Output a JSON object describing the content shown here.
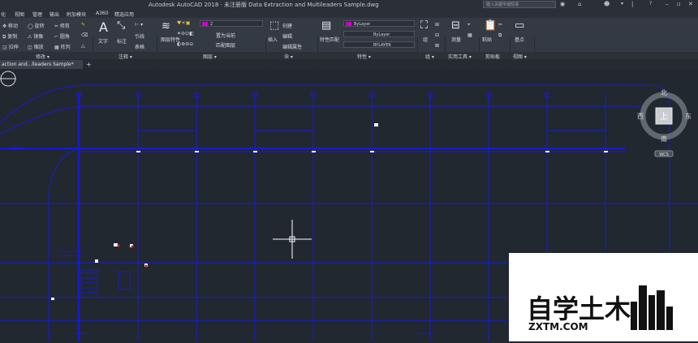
{
  "titlebar": {
    "title": "Autodesk AutoCAD 2018 · 未注册版  Data Extraction and Multileaders Sample.dwg",
    "search_placeholder": "键入关键字或短语",
    "help": "?"
  },
  "menu": [
    "化",
    "视图",
    "管理",
    "输出",
    "附加模块",
    "A360",
    "精选应用"
  ],
  "ribbon": {
    "modify": {
      "row1": [
        "✥ 移动",
        "◯ 旋转",
        "✂ 修剪"
      ],
      "row2": [
        "⧉ 复制",
        "⚠ 镜像",
        "⌐ 圆角"
      ],
      "row3": [
        "◲ 拉伸",
        "◫ 缩放",
        "▦ 阵列"
      ]
    },
    "annotation": {
      "text": "文字",
      "dim": "标注",
      "leader": "引线",
      "table": "表格"
    },
    "layers": {
      "layer_props": "图层特性",
      "layer_value": "2",
      "make_current": "置为当前",
      "match_layer": "匹配图层"
    },
    "block": {
      "insert": "插入",
      "create": "创建",
      "edit": "编辑",
      "edit_attr": "编辑属性"
    },
    "properties": {
      "match": "特性匹配",
      "color": "ByLayer",
      "linetype": "ByLayer",
      "lineweight": "BYLAYER"
    },
    "groups": {
      "group": "组"
    },
    "utilities": {
      "measure": "测量"
    },
    "clipboard": {
      "paste": "粘贴"
    },
    "view": {
      "base": "基点"
    }
  },
  "panels": [
    "修改 ▾",
    "注释 ▾",
    "图层 ▾",
    "块 ▾",
    "特性 ▾",
    "组 ▾",
    "实用工具 ▾",
    "剪贴板",
    "视图 ▾"
  ],
  "tabs": {
    "active": "action and...lleaders Sample*",
    "new": "+"
  },
  "viewcube": {
    "north": "北",
    "south": "南",
    "east": "东",
    "west": "西",
    "top": "上",
    "wcs": "WCS"
  },
  "watermark": {
    "brand": "自学土木",
    "url": "ZXTM.COM"
  },
  "colors": {
    "accent_layer": "#cc00cc",
    "drawing_lines": "#1a1ad6",
    "background": "#212830"
  }
}
